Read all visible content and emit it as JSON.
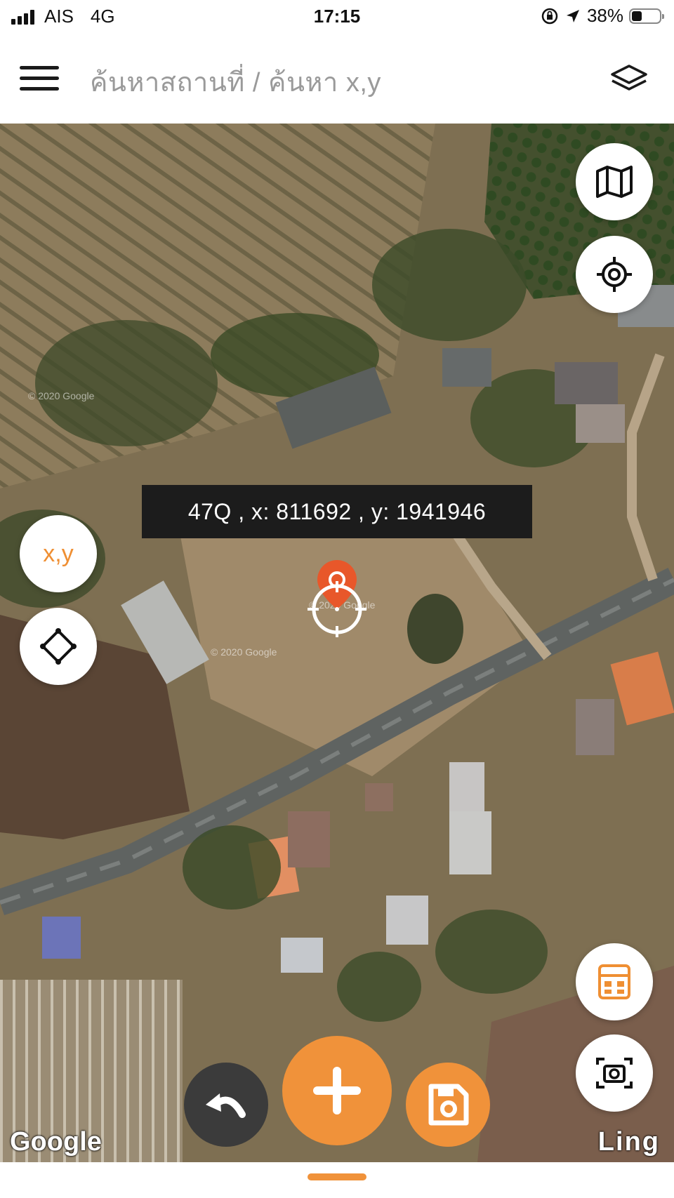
{
  "status_bar": {
    "carrier": "AIS",
    "network": "4G",
    "time": "17:15",
    "battery_percent": "38%",
    "battery_level": 0.38
  },
  "header": {
    "title": "ค้นหาสถานที่ / ค้นหา x,y",
    "menu_icon": "hamburger-menu-icon",
    "layers_icon": "layers-icon"
  },
  "map": {
    "coordinate_label": "47Q , x: 811692 , y: 1941946",
    "xy_button_label": "x,y",
    "google_logo": "Google",
    "brand_logo": "Ling",
    "watermarks": [
      "© 2020 Google",
      "© 2020 Google",
      "© 2020 Google"
    ],
    "icons": {
      "map_type": "map-icon",
      "my_location": "crosshair-icon",
      "polygon": "polygon-icon",
      "calculator": "calculator-icon",
      "screenshot": "screenshot-icon",
      "undo": "undo-icon",
      "add": "plus-icon",
      "save": "save-icon"
    }
  },
  "colors": {
    "accent": "#f0923a",
    "pin": "#e8572a",
    "dark_button": "#3b3b3b"
  }
}
